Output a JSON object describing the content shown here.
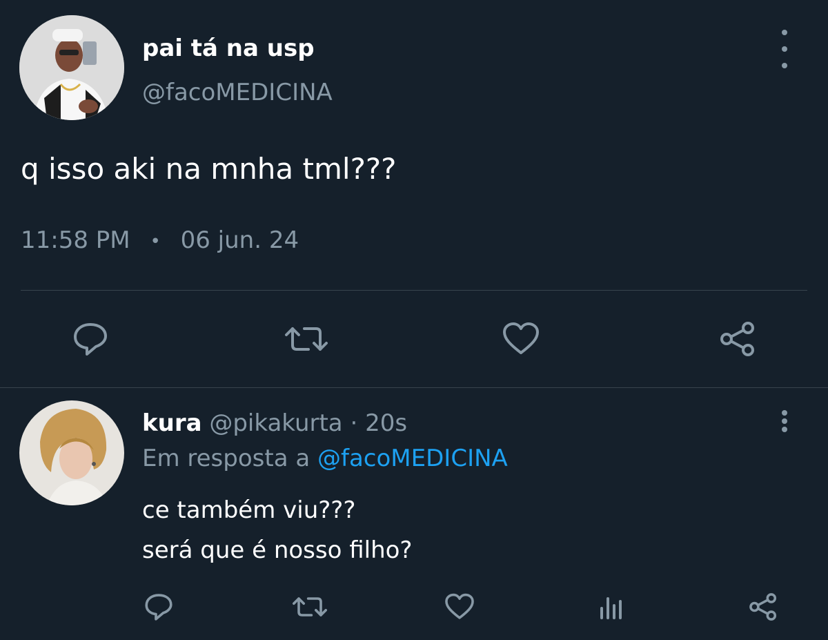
{
  "main_tweet": {
    "display_name": "pai tá na usp",
    "handle": "@facoMEDICINA",
    "text": "q isso aki na mnha tml???",
    "time": "11:58 PM",
    "separator": "•",
    "date": "06 jun. 24",
    "actions": [
      "reply-icon",
      "retweet-icon",
      "like-icon",
      "share-icon"
    ]
  },
  "reply": {
    "display_name": "kura",
    "handle": "@pikakurta",
    "dot": "·",
    "age": "20s",
    "replying_to_prefix": "Em resposta a",
    "replying_to_handle": "@facoMEDICINA",
    "lines": [
      "ce também viu???",
      "será que é nosso filho?"
    ],
    "actions": [
      "reply-icon",
      "retweet-icon",
      "like-icon",
      "analytics-icon",
      "share-icon"
    ]
  },
  "colors": {
    "background": "#15202b",
    "text": "#ffffff",
    "muted": "#8899a6",
    "accent": "#1da1f2",
    "divider": "#38444d"
  }
}
